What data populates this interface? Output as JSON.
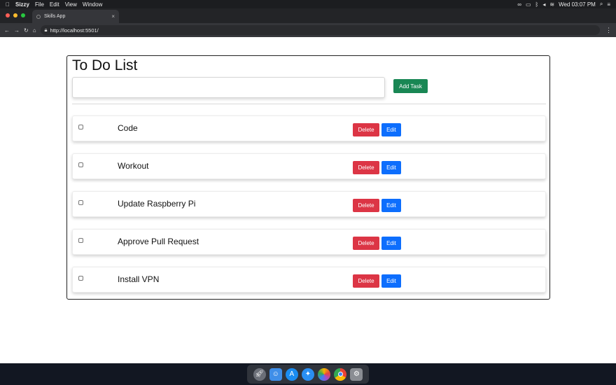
{
  "menubar": {
    "app_name": "Sizzy",
    "menus": [
      "File",
      "Edit",
      "View",
      "Window"
    ],
    "clock": "Wed 03:07 PM"
  },
  "browser": {
    "tab_title": "Skills App",
    "url": "http://localhost:5501/"
  },
  "page": {
    "title": "To Do List",
    "input_value": "",
    "add_button": "Add Task",
    "delete_label": "Delete",
    "edit_label": "Edit",
    "tasks": [
      {
        "text": "Code",
        "checked": false
      },
      {
        "text": "Workout",
        "checked": false
      },
      {
        "text": "Update Raspberry Pi",
        "checked": false
      },
      {
        "text": "Approve Pull Request",
        "checked": false
      },
      {
        "text": "Install VPN",
        "checked": false
      }
    ]
  },
  "colors": {
    "add": "#198754",
    "delete": "#dc3545",
    "edit": "#0d6efd"
  },
  "dock_icons": [
    "launchpad-icon",
    "finder-icon",
    "app-store-icon",
    "safari-icon",
    "photos-icon",
    "chrome-icon",
    "system-preferences-icon"
  ]
}
